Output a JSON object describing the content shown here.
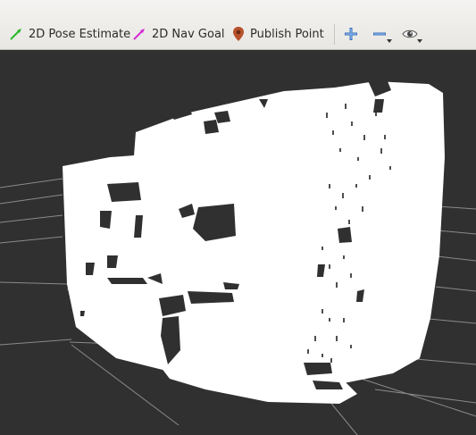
{
  "toolbar": {
    "pose_estimate_label": "2D Pose Estimate",
    "nav_goal_label": "2D Nav Goal",
    "publish_point_label": "Publish Point",
    "icons": {
      "pose_estimate": "green-arrow-icon",
      "nav_goal": "magenta-arrow-icon",
      "publish_point": "map-pin-icon",
      "add": "plus-icon",
      "remove": "minus-icon",
      "view": "eye-icon"
    }
  },
  "viewport": {
    "background": "#303030",
    "grid_color": "#8a8a8a",
    "cloud_color": "#ffffff"
  }
}
